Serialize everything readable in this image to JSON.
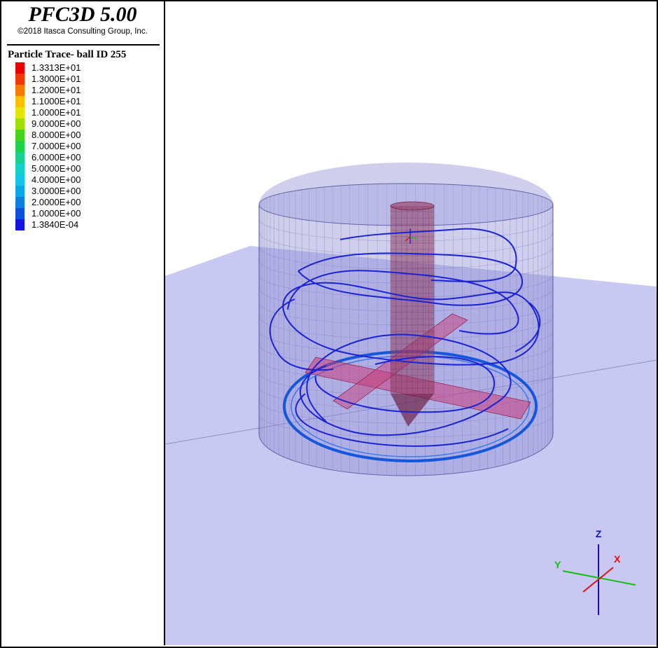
{
  "app": {
    "title": "PFC3D 5.00",
    "copyright": "©2018 Itasca Consulting Group, Inc."
  },
  "legend": {
    "title": "Particle Trace- ball  ID 255",
    "entries": [
      {
        "label": "1.3313E+01",
        "color": "#e80000"
      },
      {
        "label": "1.3000E+01",
        "color": "#f03800"
      },
      {
        "label": "1.2000E+01",
        "color": "#fa7a00"
      },
      {
        "label": "1.1000E+01",
        "color": "#ffc000"
      },
      {
        "label": "1.0000E+01",
        "color": "#e6e600"
      },
      {
        "label": "9.0000E+00",
        "color": "#9ee000"
      },
      {
        "label": "8.0000E+00",
        "color": "#46d41a"
      },
      {
        "label": "7.0000E+00",
        "color": "#1ed24a"
      },
      {
        "label": "6.0000E+00",
        "color": "#16d28e"
      },
      {
        "label": "5.0000E+00",
        "color": "#10d2c8"
      },
      {
        "label": "4.0000E+00",
        "color": "#10c8e6"
      },
      {
        "label": "3.0000E+00",
        "color": "#0aa8e8"
      },
      {
        "label": "2.0000E+00",
        "color": "#0a80e0"
      },
      {
        "label": "1.0000E+00",
        "color": "#0a50dc"
      },
      {
        "label": "1.3840E-04",
        "color": "#1414e0"
      }
    ]
  },
  "axes": {
    "x_label": "X",
    "y_label": "Y",
    "z_label": "Z",
    "x_color": "#e01010",
    "y_color": "#10c010",
    "z_color": "#1010c8"
  },
  "scene_colors": {
    "ground": "#c8c8f2",
    "container": "#8c8cd4",
    "shaft": "#8c3c64",
    "blades": "#c83c7a",
    "trace": "#1a22d4",
    "trace_bottom": "#1456dc"
  }
}
